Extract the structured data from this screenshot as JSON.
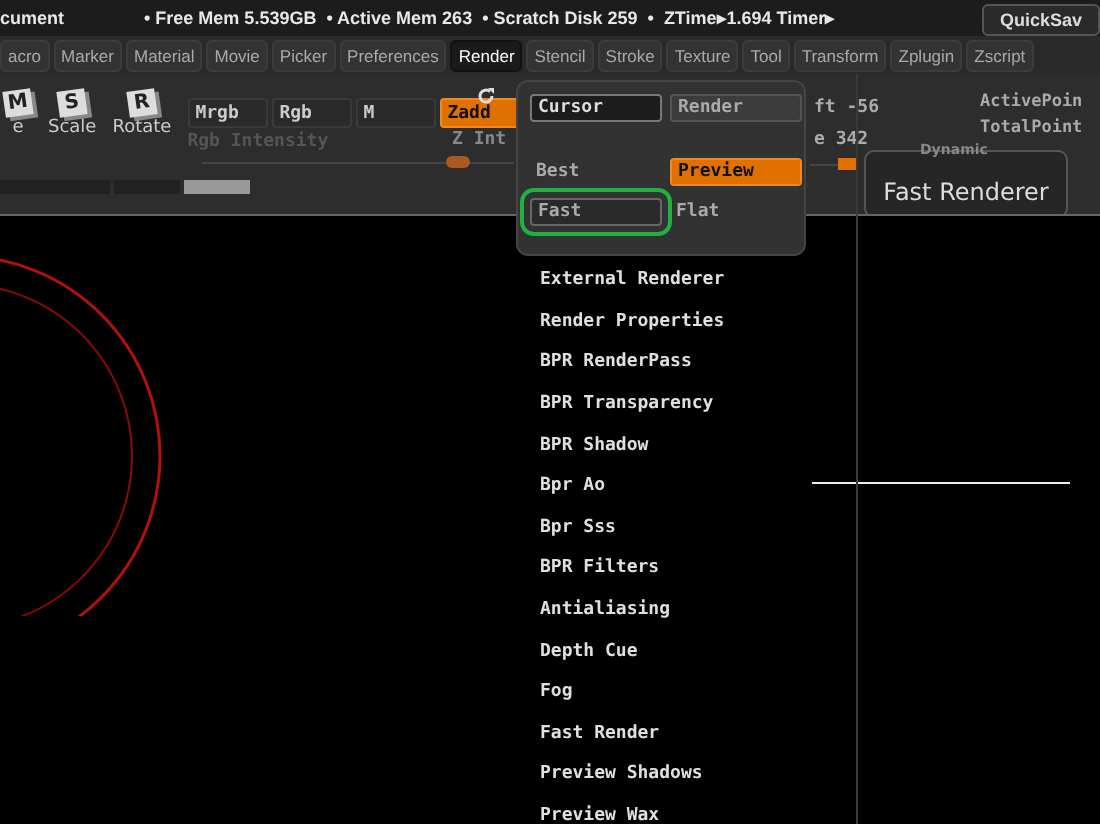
{
  "status_bar": {
    "text": "cument",
    "stats": [
      "• Free Mem 5.539GB",
      "• Active Mem 263",
      "• Scratch Disk 259",
      "•",
      "ZTime▸1.694 Timer▸"
    ],
    "quicksave": "QuickSav"
  },
  "menus": [
    {
      "label": "acro",
      "selected": false
    },
    {
      "label": "Marker",
      "selected": false
    },
    {
      "label": "Material",
      "selected": false
    },
    {
      "label": "Movie",
      "selected": false
    },
    {
      "label": "Picker",
      "selected": false
    },
    {
      "label": "Preferences",
      "selected": false
    },
    {
      "label": "Render",
      "selected": true
    },
    {
      "label": "Stencil",
      "selected": false
    },
    {
      "label": "Stroke",
      "selected": false
    },
    {
      "label": "Texture",
      "selected": false
    },
    {
      "label": "Tool",
      "selected": false
    },
    {
      "label": "Transform",
      "selected": false
    },
    {
      "label": "Zplugin",
      "selected": false
    },
    {
      "label": "Zscript",
      "selected": false
    }
  ],
  "tools": [
    {
      "key": "M",
      "label": "e"
    },
    {
      "key": "S",
      "label": "Scale"
    },
    {
      "key": "R",
      "label": "Rotate"
    }
  ],
  "modes": [
    {
      "label": "Mrgb",
      "selected": false
    },
    {
      "label": "Rgb",
      "selected": false
    },
    {
      "label": "M",
      "selected": false
    },
    {
      "label": "Zadd",
      "selected": true
    }
  ],
  "rgb_intensity": {
    "label": "Rgb Intensity",
    "level": 0.82
  },
  "z_intensity": {
    "label": "Z Int",
    "reading": "e 342",
    "level": 0.8
  },
  "draw_size": {
    "reading": "ft -56"
  },
  "points": [
    "ActivePoin",
    "TotalPoint"
  ],
  "fast_renderer": {
    "caption": "Dynamic",
    "label": "Fast Renderer"
  },
  "popup": {
    "tabs": [
      {
        "label": "Cursor",
        "selected": true
      },
      {
        "label": "Render",
        "selected": false
      }
    ],
    "render_modes": [
      {
        "label": "Best",
        "kind": "label",
        "selected": false,
        "highlighted": false
      },
      {
        "label": "Preview",
        "kind": "button",
        "selected": true,
        "highlighted": false
      },
      {
        "label": "Fast",
        "kind": "button",
        "selected": false,
        "highlighted": true
      },
      {
        "label": "Flat",
        "kind": "label",
        "selected": false,
        "highlighted": false
      }
    ]
  },
  "render_menu": [
    "External Renderer",
    "Render Properties",
    "BPR RenderPass",
    "BPR Transparency",
    "BPR Shadow",
    "Bpr Ao",
    "Bpr Sss",
    "BPR Filters",
    "Antialiasing",
    "Depth Cue",
    "Fog",
    "Fast Render",
    "Preview Shadows",
    "Preview Wax"
  ]
}
